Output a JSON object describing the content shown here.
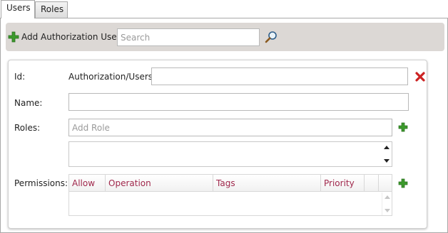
{
  "tabs": [
    {
      "label": "Users",
      "active": true
    },
    {
      "label": "Roles",
      "active": false
    }
  ],
  "toolbar": {
    "add_user_label": "Add Authorization User",
    "search_placeholder": "Search"
  },
  "form": {
    "id_label": "Id:",
    "id_prefix": "Authorization/Users/",
    "id_value": "",
    "name_label": "Name:",
    "name_value": "",
    "roles_label": "Roles:",
    "roles_placeholder": "Add Role",
    "permissions_label": "Permissions:",
    "permission_columns": [
      "Allow",
      "Operation",
      "Tags",
      "Priority"
    ]
  },
  "colors": {
    "toolbar_bg": "#dcd8d5",
    "column_header_text": "#a0284c",
    "add_icon": "#3c9a2c",
    "delete_icon": "#cc2222"
  }
}
